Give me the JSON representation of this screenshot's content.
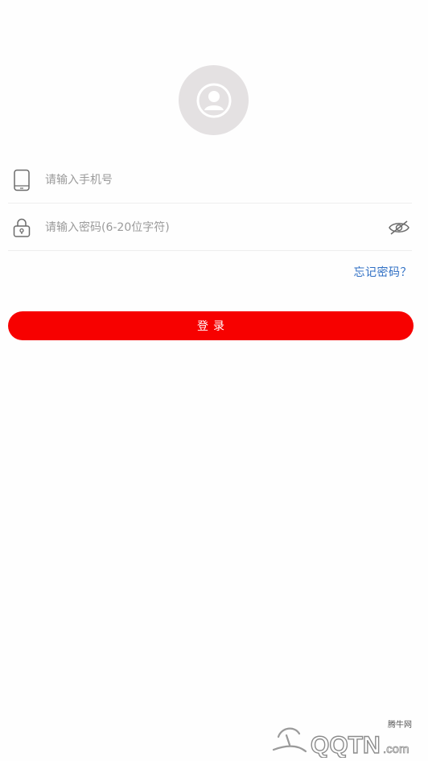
{
  "avatar": {
    "icon": "user-avatar-icon"
  },
  "phone": {
    "placeholder": "请输入手机号",
    "icon": "phone-icon"
  },
  "password": {
    "placeholder": "请输入密码(6-20位字符)",
    "icon": "lock-icon",
    "toggle_icon": "eye-closed-icon"
  },
  "forgot_label": "忘记密码？",
  "login_label": "登录",
  "watermark": {
    "site": "腾牛网",
    "brand": "QQTN.com"
  },
  "colors": {
    "accent": "#f70100",
    "link": "#2f6fc4",
    "placeholder": "#9b9b9b",
    "avatar_bg": "#e4e1e2"
  }
}
